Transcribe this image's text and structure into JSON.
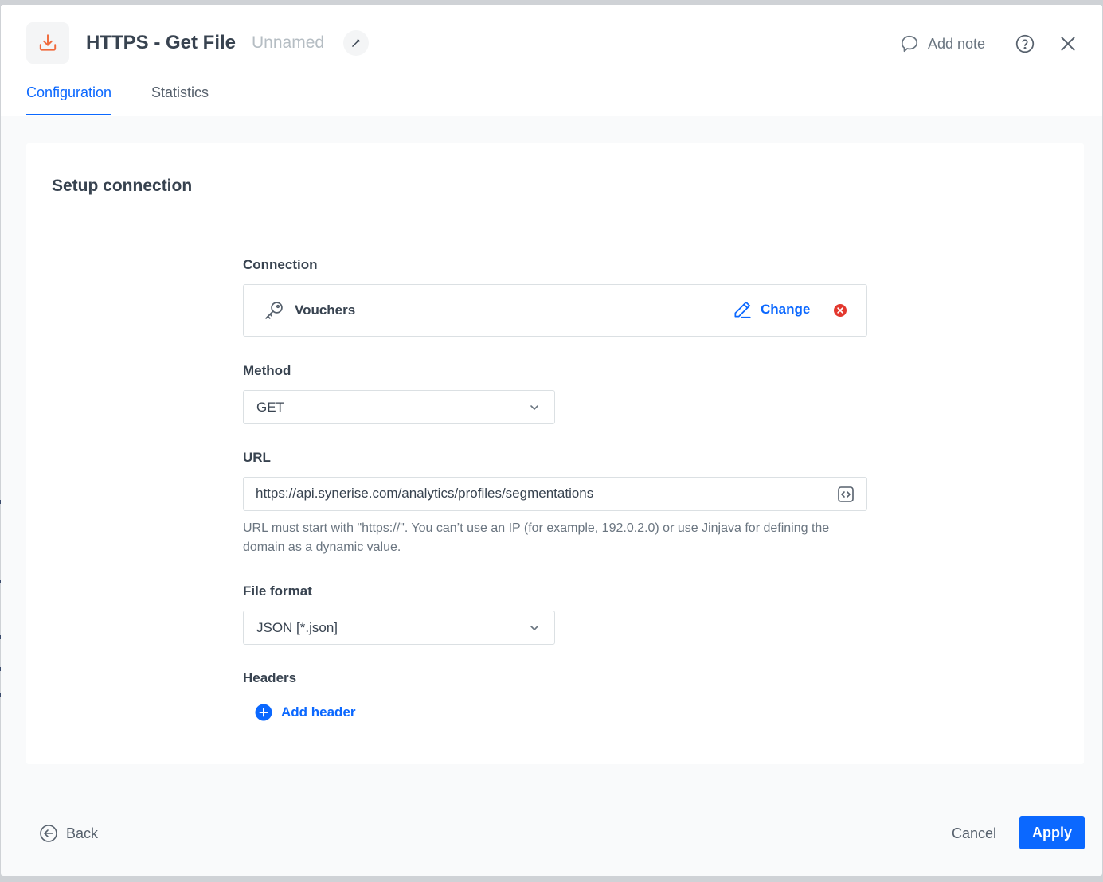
{
  "header": {
    "title": "HTTPS - Get File",
    "subtitle": "Unnamed",
    "add_note_label": "Add note"
  },
  "tabs": [
    {
      "label": "Configuration",
      "active": true
    },
    {
      "label": "Statistics",
      "active": false
    }
  ],
  "card": {
    "title": "Setup connection"
  },
  "connection": {
    "label": "Connection",
    "name": "Vouchers",
    "change_label": "Change"
  },
  "method": {
    "label": "Method",
    "value": "GET"
  },
  "url": {
    "label": "URL",
    "value": "https://api.synerise.com/analytics/profiles/segmentations",
    "hint": "URL must start with \"https://\". You can’t use an IP (for example, 192.0.2.0) or use Jinjava for defining the domain as a dynamic value."
  },
  "file_format": {
    "label": "File format",
    "value": "JSON [*.json]"
  },
  "headers": {
    "label": "Headers",
    "add_label": "Add header"
  },
  "footer": {
    "back_label": "Back",
    "cancel_label": "Cancel",
    "apply_label": "Apply"
  },
  "colors": {
    "accent": "#0b68ff",
    "icon_orange": "#f06a3c",
    "danger": "#e3382e"
  },
  "icons": {
    "app": "download-icon",
    "edit": "pencil-icon",
    "note": "speech-bubble-icon",
    "help": "question-circle-icon",
    "close": "close-icon",
    "key": "key-icon",
    "change": "pencil-icon",
    "remove": "remove-circle-icon",
    "dropdown": "chevron-down-icon",
    "code": "code-icon",
    "add": "plus-circle-icon",
    "back": "arrow-left-circle-icon"
  }
}
